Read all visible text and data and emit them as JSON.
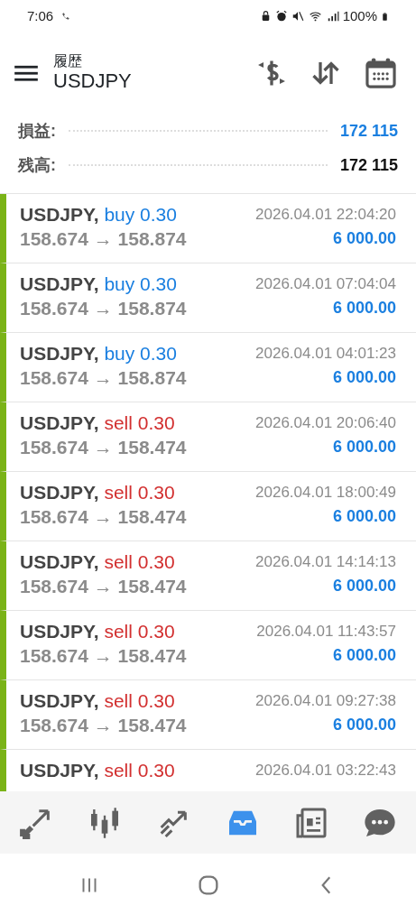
{
  "status_bar": {
    "time": "7:06",
    "battery": "100%"
  },
  "header": {
    "subtitle": "履歴",
    "title": "USDJPY"
  },
  "summary": [
    {
      "label": "損益:",
      "value": "172 115",
      "kind": "profit"
    },
    {
      "label": "残高:",
      "value": "172 115",
      "kind": "balance"
    }
  ],
  "trades": [
    {
      "symbol": "USDJPY,",
      "side": "buy",
      "volume": "0.30",
      "time": "2026.04.01 22:04:20",
      "prices": "158.674 → 158.874",
      "profit": "6 000.00"
    },
    {
      "symbol": "USDJPY,",
      "side": "buy",
      "volume": "0.30",
      "time": "2026.04.01 07:04:04",
      "prices": "158.674 → 158.874",
      "profit": "6 000.00"
    },
    {
      "symbol": "USDJPY,",
      "side": "buy",
      "volume": "0.30",
      "time": "2026.04.01 04:01:23",
      "prices": "158.674 → 158.874",
      "profit": "6 000.00"
    },
    {
      "symbol": "USDJPY,",
      "side": "sell",
      "volume": "0.30",
      "time": "2026.04.01 20:06:40",
      "prices": "158.674 → 158.474",
      "profit": "6 000.00"
    },
    {
      "symbol": "USDJPY,",
      "side": "sell",
      "volume": "0.30",
      "time": "2026.04.01 18:00:49",
      "prices": "158.674 → 158.474",
      "profit": "6 000.00"
    },
    {
      "symbol": "USDJPY,",
      "side": "sell",
      "volume": "0.30",
      "time": "2026.04.01 14:14:13",
      "prices": "158.674 → 158.474",
      "profit": "6 000.00"
    },
    {
      "symbol": "USDJPY,",
      "side": "sell",
      "volume": "0.30",
      "time": "2026.04.01 11:43:57",
      "prices": "158.674 → 158.474",
      "profit": "6 000.00"
    },
    {
      "symbol": "USDJPY,",
      "side": "sell",
      "volume": "0.30",
      "time": "2026.04.01 09:27:38",
      "prices": "158.674 → 158.474",
      "profit": "6 000.00"
    },
    {
      "symbol": "USDJPY,",
      "side": "sell",
      "volume": "0.30",
      "time": "2026.04.01 03:22:43"
    }
  ],
  "bottom_nav": [
    {
      "kind": "quotes",
      "selected": false
    },
    {
      "kind": "chart",
      "selected": false
    },
    {
      "kind": "trade",
      "selected": false
    },
    {
      "kind": "history",
      "selected": true
    },
    {
      "kind": "news",
      "selected": false
    },
    {
      "kind": "chat",
      "selected": false
    }
  ]
}
